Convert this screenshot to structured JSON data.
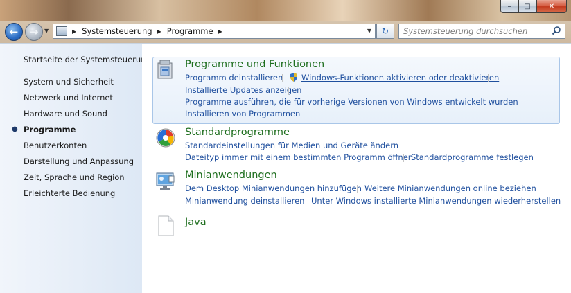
{
  "window": {
    "caption_min": "–",
    "caption_max": "□",
    "caption_close": "✕"
  },
  "address_bar": {
    "crumbs": [
      "Systemsteuerung",
      "Programme"
    ]
  },
  "search": {
    "placeholder": "Systemsteuerung durchsuchen"
  },
  "sidebar": {
    "items": [
      {
        "label": "Startseite der Systemsteuerung"
      },
      {
        "label": "System und Sicherheit"
      },
      {
        "label": "Netzwerk und Internet"
      },
      {
        "label": "Hardware und Sound"
      },
      {
        "label": "Programme",
        "active": true
      },
      {
        "label": "Benutzerkonten"
      },
      {
        "label": "Darstellung und Anpassung"
      },
      {
        "label": "Zeit, Sprache und Region"
      },
      {
        "label": "Erleichterte Bedienung"
      }
    ]
  },
  "sections": [
    {
      "title": "Programme und Funktionen",
      "icon": "programs-features-icon",
      "links": [
        "Programm deinstallieren",
        "Windows-Funktionen aktivieren oder deaktivieren",
        "Installierte Updates anzeigen",
        "Programme ausführen, die für vorherige Versionen von Windows entwickelt wurden",
        "Installieren von Programmen"
      ]
    },
    {
      "title": "Standardprogramme",
      "icon": "default-programs-icon",
      "links": [
        "Standardeinstellungen für Medien und Geräte ändern",
        "Dateityp immer mit einem bestimmten Programm öffnen",
        "Standardprogramme festlegen"
      ]
    },
    {
      "title": "Minianwendungen",
      "icon": "gadgets-icon",
      "links": [
        "Dem Desktop Minianwendungen hinzufügen",
        "Weitere Minianwendungen online beziehen",
        "Minianwendung deinstallieren",
        "Unter Windows installierte Minianwendungen wiederherstellen"
      ]
    },
    {
      "title": "Java",
      "icon": "java-document-icon",
      "links": []
    }
  ],
  "colors": {
    "section_title": "#1e6e1e",
    "link": "#1f4f9e",
    "highlight_border": "#a9c6e8"
  }
}
